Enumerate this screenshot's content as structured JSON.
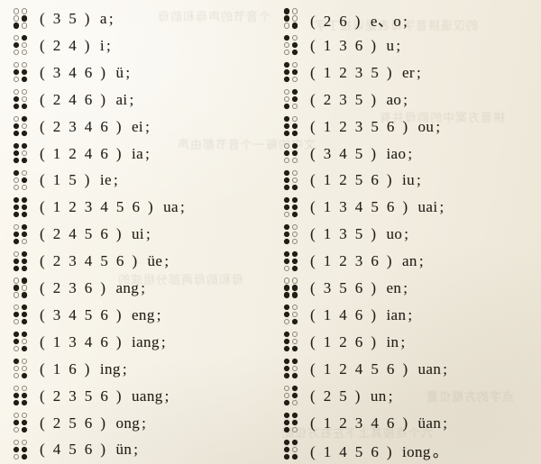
{
  "page": {
    "kind": "scanned-book-page",
    "description": "Chinese braille finals (yunmu) chart: braille cell, dot-number code, and pinyin final",
    "background_color": "#f6f2e8",
    "ink_color": "#242016",
    "columns": 2
  },
  "legend": {
    "dot_numbering": "1-2-3 left column top to bottom, 4-5-6 right column top to bottom"
  },
  "showthrough_text": [
    "的汉语拼音字母表是以拉丁字",
    "个音节的声母和韵母",
    "拼音方案中的韵母共有",
    "文中的每一个音节都由声",
    "母和韵母两部分组成的",
    "点字的方框位置",
    "六个点按其上下左右方位配"
  ],
  "columns": {
    "left": [
      {
        "code": "( 3 5 )",
        "dots": [
          0,
          0,
          1,
          0,
          1,
          0
        ],
        "roman": "a",
        "punct": ";"
      },
      {
        "code": "( 2 4 )",
        "dots": [
          0,
          1,
          0,
          1,
          0,
          0
        ],
        "roman": "i",
        "punct": ";"
      },
      {
        "code": "( 3 4 6 )",
        "dots": [
          0,
          1,
          0,
          0,
          1,
          1
        ],
        "roman": "ü",
        "punct": ";"
      },
      {
        "code": "( 2 4 6 )",
        "dots": [
          0,
          1,
          1,
          0,
          0,
          1
        ],
        "roman": "ai",
        "punct": ";"
      },
      {
        "code": "( 2 3 4 6 )",
        "dots": [
          0,
          1,
          1,
          1,
          0,
          1
        ],
        "roman": "ei",
        "punct": ";"
      },
      {
        "code": "( 1 2 4 6 )",
        "dots": [
          1,
          1,
          1,
          1,
          0,
          1
        ],
        "roman": "ia",
        "punct": ";"
      },
      {
        "code": "( 1 5 )",
        "dots": [
          1,
          0,
          0,
          0,
          1,
          0
        ],
        "roman": "ie",
        "punct": ";"
      },
      {
        "code": "( 1 2 3 4 5 6 )",
        "dots": [
          1,
          1,
          1,
          1,
          1,
          1
        ],
        "roman": "ua",
        "punct": ";"
      },
      {
        "code": "( 2 4 5 6 )",
        "dots": [
          0,
          1,
          1,
          1,
          1,
          0
        ],
        "roman": "ui",
        "punct": ";"
      },
      {
        "code": "( 2 3 4 5 6 )",
        "dots": [
          0,
          1,
          1,
          1,
          1,
          1
        ],
        "roman": "üe",
        "punct": ";"
      },
      {
        "code": "( 2 3 6 )",
        "dots": [
          0,
          1,
          0,
          1,
          0,
          1
        ],
        "roman": "ang",
        "punct": ";"
      },
      {
        "code": "( 3 4 5 6 )",
        "dots": [
          0,
          1,
          0,
          1,
          1,
          1
        ],
        "roman": "eng",
        "punct": ";"
      },
      {
        "code": "( 1 3 4 6 )",
        "dots": [
          1,
          1,
          0,
          1,
          0,
          1
        ],
        "roman": "iang",
        "punct": ";"
      },
      {
        "code": "( 1 6 )",
        "dots": [
          1,
          0,
          0,
          0,
          0,
          1
        ],
        "roman": "ing",
        "punct": ";"
      },
      {
        "code": "( 2 3 5 6 )",
        "dots": [
          0,
          1,
          1,
          0,
          1,
          1
        ],
        "roman": "uang",
        "punct": ";"
      },
      {
        "code": "( 2 5 6 )",
        "dots": [
          0,
          1,
          0,
          0,
          1,
          1
        ],
        "roman": "ong",
        "punct": ";"
      },
      {
        "code": "( 4 5 6 )",
        "dots": [
          0,
          1,
          0,
          0,
          1,
          1
        ],
        "roman": "ün",
        "punct": ";"
      }
    ],
    "right": [
      {
        "code": "( 2 6 )",
        "dots": [
          1,
          1,
          0,
          0,
          0,
          1
        ],
        "roman": "e、o",
        "punct": ";"
      },
      {
        "code": "( 1 3 6 )",
        "dots": [
          1,
          0,
          0,
          0,
          1,
          1
        ],
        "roman": "u",
        "punct": ";"
      },
      {
        "code": "( 1 2 3 5 )",
        "dots": [
          1,
          1,
          1,
          0,
          1,
          0
        ],
        "roman": "er",
        "punct": ";"
      },
      {
        "code": "( 2 3 5 )",
        "dots": [
          0,
          0,
          1,
          1,
          1,
          0
        ],
        "roman": "ao",
        "punct": ";"
      },
      {
        "code": "( 1 2 3 5 6 )",
        "dots": [
          1,
          1,
          1,
          0,
          1,
          1
        ],
        "roman": "ou",
        "punct": ";"
      },
      {
        "code": "( 3 4 5 )",
        "dots": [
          0,
          1,
          0,
          1,
          1,
          0
        ],
        "roman": "iao",
        "punct": ";"
      },
      {
        "code": "( 1 2 5 6 )",
        "dots": [
          1,
          1,
          1,
          0,
          0,
          1
        ],
        "roman": "iu",
        "punct": ";"
      },
      {
        "code": "( 1 3 4 5 6 )",
        "dots": [
          1,
          1,
          0,
          1,
          1,
          1
        ],
        "roman": "uai",
        "punct": ";"
      },
      {
        "code": "( 1 3 5 )",
        "dots": [
          1,
          1,
          1,
          0,
          0,
          0
        ],
        "roman": "uo",
        "punct": ";"
      },
      {
        "code": "( 1 2 3 6 )",
        "dots": [
          1,
          1,
          0,
          1,
          1,
          1
        ],
        "roman": "an",
        "punct": ";"
      },
      {
        "code": "( 3 5 6 )",
        "dots": [
          0,
          1,
          1,
          0,
          1,
          1
        ],
        "roman": "en",
        "punct": ";"
      },
      {
        "code": "( 1 4 6 )",
        "dots": [
          1,
          1,
          0,
          0,
          0,
          1
        ],
        "roman": "ian",
        "punct": ";"
      },
      {
        "code": "( 1 2 6 )",
        "dots": [
          1,
          1,
          1,
          0,
          0,
          1
        ],
        "roman": "in",
        "punct": ";"
      },
      {
        "code": "( 1 2 4 5 6 )",
        "dots": [
          1,
          1,
          1,
          1,
          0,
          1
        ],
        "roman": "uan",
        "punct": ";"
      },
      {
        "code": "( 2 5 )",
        "dots": [
          0,
          0,
          1,
          1,
          1,
          0
        ],
        "roman": "un",
        "punct": ";"
      },
      {
        "code": "( 1 2 3 4 6 )",
        "dots": [
          1,
          1,
          1,
          1,
          1,
          0
        ],
        "roman": "üan",
        "punct": ";"
      },
      {
        "code": "( 1 4 5 6 )",
        "dots": [
          1,
          1,
          1,
          1,
          0,
          1
        ],
        "roman": "iong",
        "punct": "。"
      }
    ]
  }
}
